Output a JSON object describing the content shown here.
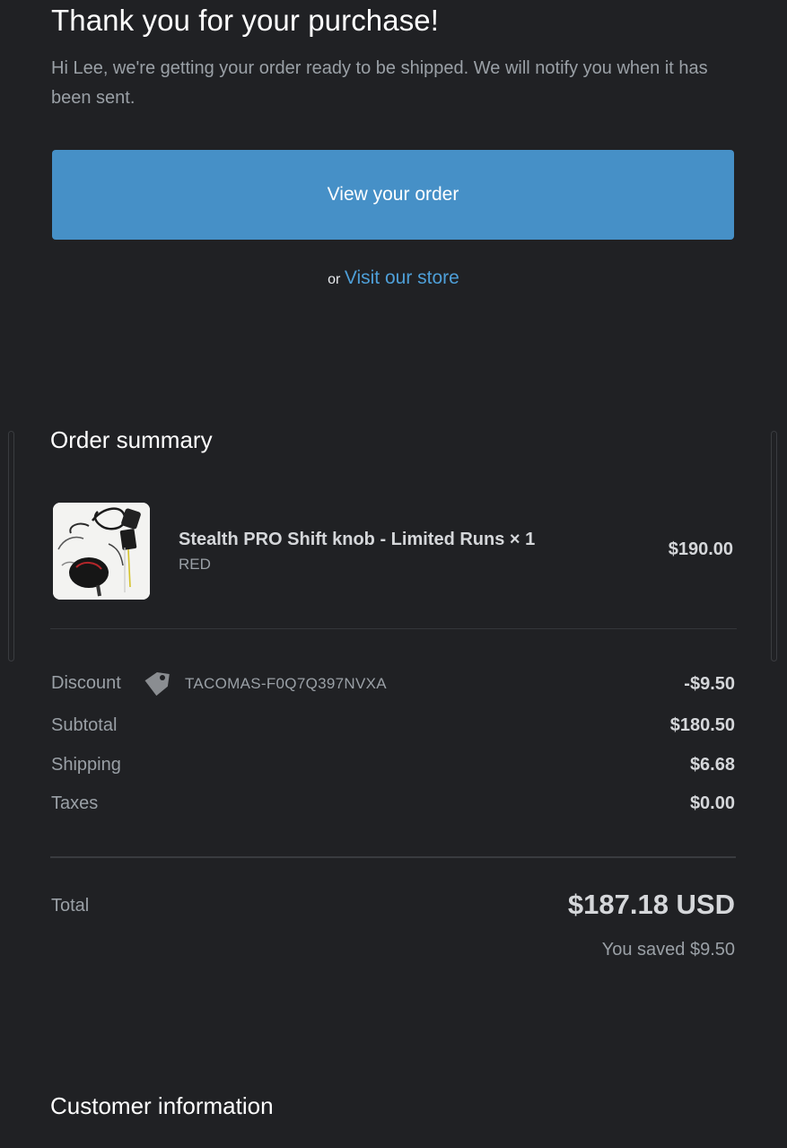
{
  "header": {
    "title": "Thank you for your purchase!",
    "intro": "Hi Lee, we're getting your order ready to be shipped. We will notify you when it has been sent."
  },
  "actions": {
    "view_order_label": "View your order",
    "or_text": "or",
    "visit_store_label": "Visit our store"
  },
  "order_summary": {
    "heading": "Order summary",
    "item": {
      "name": "Stealth PRO Shift knob - Limited Runs × 1",
      "variant": "RED",
      "price": "$190.00",
      "image_icon": "shift-knob-product-photo"
    },
    "discount": {
      "label": "Discount",
      "icon": "tag-icon",
      "code": "TACOMAS-F0Q7Q397NVXA",
      "value": "-$9.50"
    },
    "subtotal": {
      "label": "Subtotal",
      "value": "$180.50"
    },
    "shipping": {
      "label": "Shipping",
      "value": "$6.68"
    },
    "taxes": {
      "label": "Taxes",
      "value": "$0.00"
    },
    "total": {
      "label": "Total",
      "value": "$187.18 USD"
    },
    "saved": "You saved $9.50"
  },
  "customer_information": {
    "heading": "Customer information"
  },
  "colors": {
    "background": "#202124",
    "button": "#4690c7",
    "link": "#4e9fd8"
  }
}
